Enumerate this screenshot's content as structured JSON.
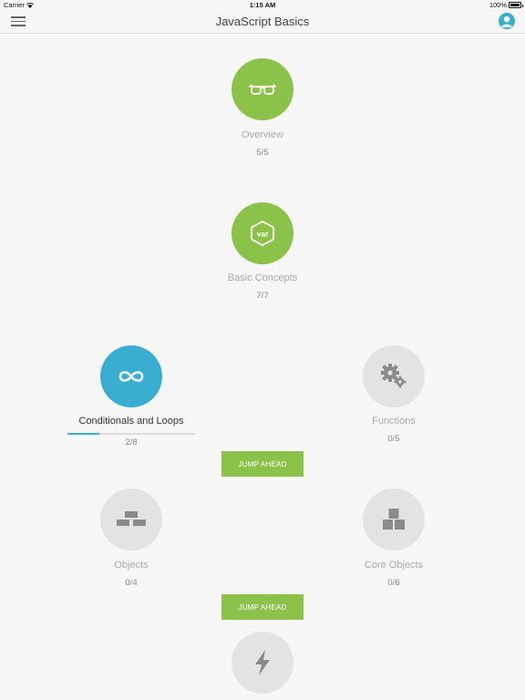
{
  "status": {
    "carrier": "Carrier",
    "time": "1:15 AM",
    "battery": "100%"
  },
  "nav": {
    "title": "JavaScript Basics",
    "menu_icon": "hamburger-menu-icon",
    "profile_icon": "user-profile-icon"
  },
  "colors": {
    "complete": "#8bc34a",
    "in_progress": "#3aaed0",
    "locked": "#e3e3e3",
    "jump_button": "#8bc34a"
  },
  "nodes": [
    {
      "label": "Overview",
      "count": "5/5",
      "state": "complete",
      "icon": "glasses-icon"
    },
    {
      "label": "Basic Concepts",
      "count": "7/7",
      "state": "complete",
      "icon": "var-hexagon-icon"
    },
    {
      "label": "Conditionals and Loops",
      "count": "2/8",
      "state": "in_progress",
      "icon": "infinity-icon",
      "progress": 0.25
    },
    {
      "label": "Functions",
      "count": "0/5",
      "state": "locked",
      "icon": "gears-icon"
    },
    {
      "label": "Objects",
      "count": "0/4",
      "state": "locked",
      "icon": "bricks-icon"
    },
    {
      "label": "Core Objects",
      "count": "0/6",
      "state": "locked",
      "icon": "boxes-icon"
    },
    {
      "label": "",
      "count": "",
      "state": "locked",
      "icon": "lightning-icon"
    }
  ],
  "jump_buttons": [
    {
      "label": "JUMP AHEAD"
    },
    {
      "label": "JUMP AHEAD"
    }
  ]
}
